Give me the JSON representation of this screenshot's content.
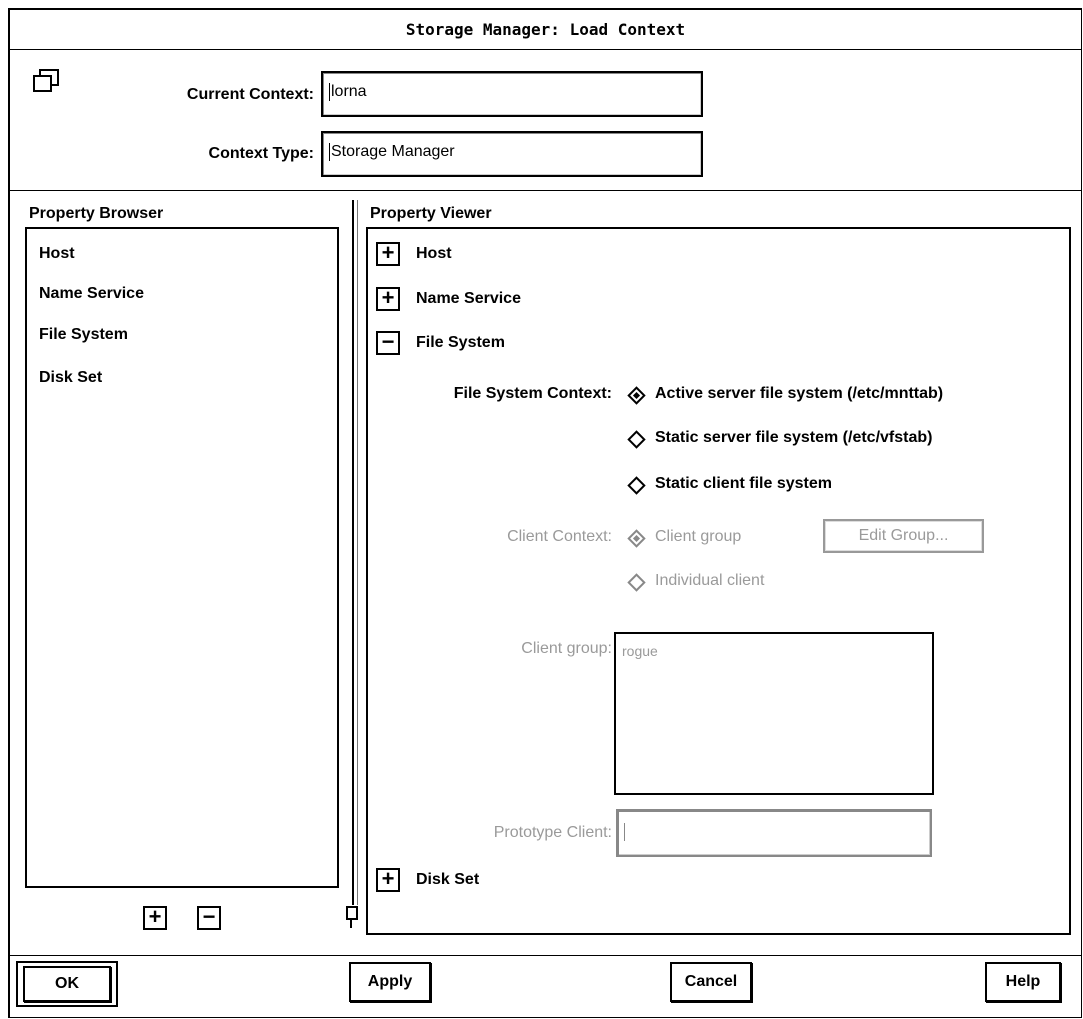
{
  "window": {
    "title": "Storage Manager: Load Context"
  },
  "header": {
    "icon": "window-restore-icon",
    "current_context_label": "Current Context:",
    "current_context_value": "lorna",
    "context_type_label": "Context Type:",
    "context_type_value": "Storage Manager"
  },
  "browser": {
    "title": "Property Browser",
    "items": [
      "Host",
      "Name Service",
      "File System",
      "Disk Set"
    ],
    "expand_label": "+",
    "collapse_label": "−"
  },
  "viewer": {
    "title": "Property Viewer",
    "sections": [
      {
        "label": "Host",
        "toggle": "+"
      },
      {
        "label": "Name Service",
        "toggle": "+"
      },
      {
        "label": "File System",
        "toggle": "−"
      },
      {
        "label": "Disk Set",
        "toggle": "+"
      }
    ],
    "fs_context_label": "File System Context:",
    "fs_options": [
      {
        "label": "Active server file system (/etc/mnttab)",
        "selected": true
      },
      {
        "label": "Static server file system (/etc/vfstab)",
        "selected": false
      },
      {
        "label": "Static client file system",
        "selected": false
      }
    ],
    "client_context_label": "Client Context:",
    "client_options": [
      {
        "label": "Client group",
        "selected": true
      },
      {
        "label": "Individual client",
        "selected": false
      }
    ],
    "edit_group_label": "Edit Group...",
    "client_group_label": "Client group:",
    "client_group_value": "rogue",
    "prototype_client_label": "Prototype Client:",
    "prototype_client_value": ""
  },
  "footer": {
    "ok": "OK",
    "apply": "Apply",
    "cancel": "Cancel",
    "help": "Help"
  }
}
